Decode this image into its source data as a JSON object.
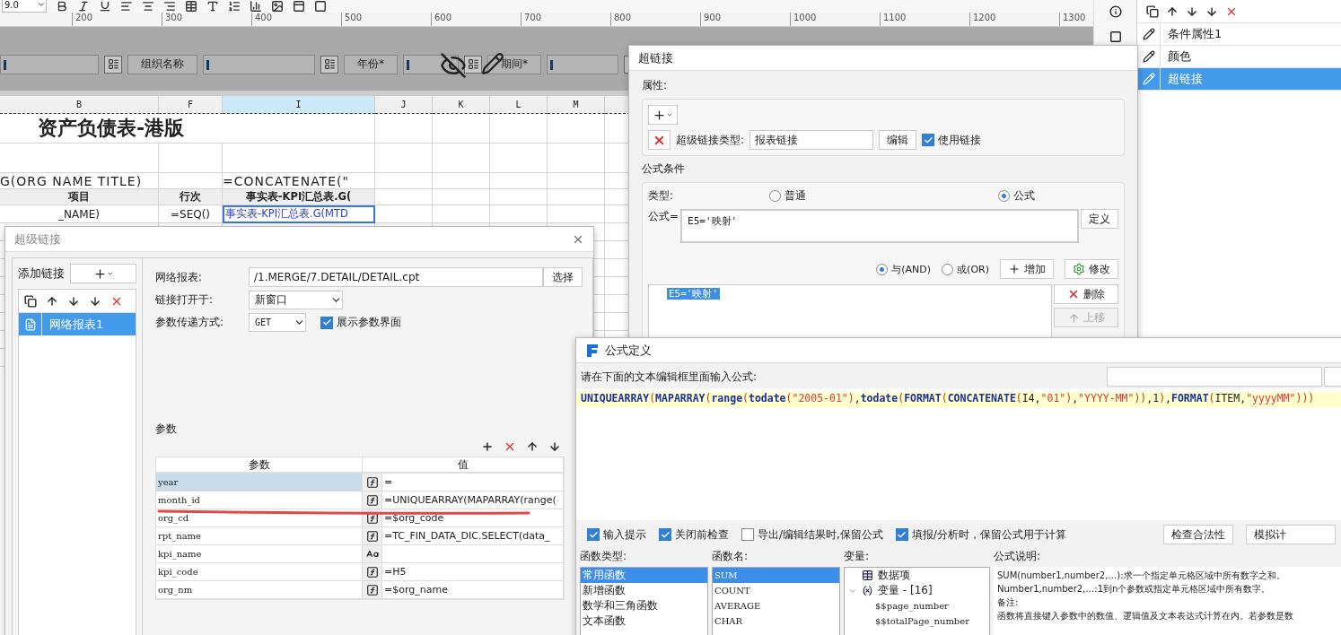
{
  "toolbar": {
    "font_size": "9.0"
  },
  "ruler": {
    "ticks": [
      "200",
      "300",
      "400",
      "500",
      "600",
      "700",
      "800",
      "900",
      "1000",
      "1100",
      "1200",
      "1300"
    ]
  },
  "parameters": [
    {
      "label": "组织名称"
    },
    {
      "label": "年份*"
    },
    {
      "label": "期间*"
    }
  ],
  "sheet": {
    "columns": [
      {
        "label": "B",
        "selected": false
      },
      {
        "label": "F",
        "selected": false
      },
      {
        "label": "I",
        "selected": true
      },
      {
        "label": "J",
        "selected": false
      },
      {
        "label": "K",
        "selected": false
      },
      {
        "label": "L",
        "selected": false
      },
      {
        "label": "M",
        "selected": false
      }
    ],
    "rows": [
      {
        "kind": "title",
        "cells": [
          {
            "text": "资产负债表-港版",
            "selected": false
          }
        ]
      },
      {
        "kind": "formula",
        "cells": [
          {
            "text": "G(ORG NAME TITLE)",
            "selected": false
          },
          {
            "text": "",
            "selected": false
          },
          {
            "text": "=CONCATENATE(\"",
            "selected": false
          }
        ]
      },
      {
        "kind": "header",
        "cells": [
          {
            "text": "项目",
            "selected": false
          },
          {
            "text": "行次",
            "selected": false
          },
          {
            "text": "事实表-KPI汇总表.G(",
            "selected": false
          }
        ]
      },
      {
        "kind": "data",
        "cells": [
          {
            "text": "_NAME)",
            "selected": false
          },
          {
            "text": "=SEQ()",
            "selected": false
          },
          {
            "text": "事实表-KPI汇总表.G(MTD",
            "selected": true
          }
        ]
      }
    ]
  },
  "condition_panel": {
    "items": [
      {
        "label": "条件属性1",
        "selected": false
      },
      {
        "label": "颜色",
        "selected": false
      },
      {
        "label": "超链接",
        "selected": true
      }
    ]
  },
  "hyperlink_dialog": {
    "title": "超链接",
    "properties_label": "属性:",
    "type_label": "超级链接类型:",
    "type_value": "报表链接",
    "edit_button": "编辑",
    "use_link": {
      "label": "使用链接",
      "checked": true
    },
    "condition_group": "公式条件",
    "kind_label": "类型:",
    "kind_options": [
      {
        "label": "普通",
        "selected": false
      },
      {
        "label": "公式",
        "selected": true
      }
    ],
    "formula_label": "公式=",
    "formula_value": "E5='映射'",
    "define_button": "定义",
    "logic_options": [
      {
        "label": "与(AND)",
        "selected": true
      },
      {
        "label": "或(OR)",
        "selected": false
      }
    ],
    "add_button": "增加",
    "modify_button": "修改",
    "conditions": [
      {
        "text": "E5='映射'",
        "selected": true
      }
    ],
    "delete_button": "删除",
    "move_up_button": {
      "label": "上移",
      "disabled": true
    }
  },
  "link_dialog": {
    "title": "超级链接",
    "add_label": "添加链接",
    "links": [
      {
        "label": "网络报表1",
        "selected": true
      }
    ],
    "report_label": "网络报表:",
    "report_path": "/1.MERGE/7.DETAIL/DETAIL.cpt",
    "choose_button": "选择",
    "open_in_label": "链接打开于:",
    "open_in": "新窗口",
    "method_label": "参数传递方式:",
    "method": "GET",
    "show_params": {
      "label": "展示参数界面",
      "checked": true
    },
    "params_label": "参数",
    "columns": [
      "参数",
      "值"
    ],
    "params": [
      {
        "name": "year",
        "kind": "formula",
        "value": "=",
        "selected": true
      },
      {
        "name": "month_id",
        "kind": "formula",
        "value": "=UNIQUEARRAY(MAPARRAY(range(",
        "selected": false
      },
      {
        "name": "org_cd",
        "kind": "formula",
        "value": "=$org_code",
        "selected": false
      },
      {
        "name": "rpt_name",
        "kind": "formula",
        "value": "=TC_FIN_DATA_DIC.SELECT(data_",
        "selected": false
      },
      {
        "name": "kpi_name",
        "kind": "string",
        "selected": false
      },
      {
        "name": "kpi_code",
        "kind": "formula",
        "value": "=H5",
        "selected": false
      },
      {
        "name": "org_nm",
        "kind": "formula",
        "value": "=$org_name",
        "selected": false
      }
    ]
  },
  "formula_dialog": {
    "title": "公式定义",
    "prompt": "请在下面的文本编辑框里面输入公式:",
    "tokens": [
      {
        "kind": "fn",
        "text": "UNIQUEARRAY"
      },
      {
        "kind": "paren",
        "text": "("
      },
      {
        "kind": "fn",
        "text": "MAPARRAY"
      },
      {
        "kind": "paren",
        "text": "("
      },
      {
        "kind": "fn",
        "text": "range"
      },
      {
        "kind": "paren",
        "text": "("
      },
      {
        "kind": "fn",
        "text": "todate"
      },
      {
        "kind": "paren",
        "text": "("
      },
      {
        "kind": "str",
        "text": "\"2005-01\""
      },
      {
        "kind": "paren",
        "text": ")"
      },
      {
        "kind": "plain",
        "text": ","
      },
      {
        "kind": "fn",
        "text": "todate"
      },
      {
        "kind": "paren",
        "text": "("
      },
      {
        "kind": "fn",
        "text": "FORMAT"
      },
      {
        "kind": "paren",
        "text": "("
      },
      {
        "kind": "fn",
        "text": "CONCATENATE"
      },
      {
        "kind": "paren",
        "text": "("
      },
      {
        "kind": "plain",
        "text": "I4,"
      },
      {
        "kind": "str",
        "text": "\"01\""
      },
      {
        "kind": "paren",
        "text": ")"
      },
      {
        "kind": "plain",
        "text": ","
      },
      {
        "kind": "str",
        "text": "\"YYYY-MM\""
      },
      {
        "kind": "paren",
        "text": "))"
      },
      {
        "kind": "plain",
        "text": ",1"
      },
      {
        "kind": "paren",
        "text": ")"
      },
      {
        "kind": "plain",
        "text": ","
      },
      {
        "kind": "fn",
        "text": "FORMAT"
      },
      {
        "kind": "paren",
        "text": "("
      },
      {
        "kind": "plain",
        "text": "ITEM,"
      },
      {
        "kind": "str",
        "text": "\"yyyyMM\""
      },
      {
        "kind": "paren",
        "text": ")))"
      }
    ],
    "options": [
      {
        "label": "输入提示",
        "checked": true
      },
      {
        "label": "关闭前检查",
        "checked": true
      },
      {
        "label": "导出/编辑结果时,保留公式",
        "checked": false
      },
      {
        "label": "填报/分析时，保留公式用于计算",
        "checked": true
      }
    ],
    "check_button": "检查合法性",
    "simulate_button": "模拟计",
    "function_types_label": "函数类型:",
    "function_types": [
      {
        "label": "常用函数",
        "selected": true
      },
      {
        "label": "新增函数",
        "selected": false
      },
      {
        "label": "数学和三角函数",
        "selected": false
      },
      {
        "label": "文本函数",
        "selected": false
      }
    ],
    "function_names_label": "函数名:",
    "function_names": [
      {
        "label": "SUM",
        "selected": true
      },
      {
        "label": "COUNT",
        "selected": false
      },
      {
        "label": "AVERAGE",
        "selected": false
      },
      {
        "label": "CHAR",
        "selected": false
      }
    ],
    "variables_label": "变量:",
    "variables": [
      {
        "label": "数据项",
        "kind": "data"
      },
      {
        "label": "变量 - [16]",
        "kind": "group",
        "expanded": true,
        "children": [
          {
            "label": "$$page_number"
          },
          {
            "label": "$$totalPage_number"
          }
        ]
      }
    ],
    "description_label": "公式说明:",
    "description": [
      "SUM(number1,number2,…):求一个指定单元格区域中所有数字之和。",
      "Number1,number2,…:1到n个参数或指定单元格区域中所有数字。",
      "备注:",
      "函数将直接键入参数中的数值、逻辑值及文本表达式计算在内。若参数是数"
    ]
  }
}
